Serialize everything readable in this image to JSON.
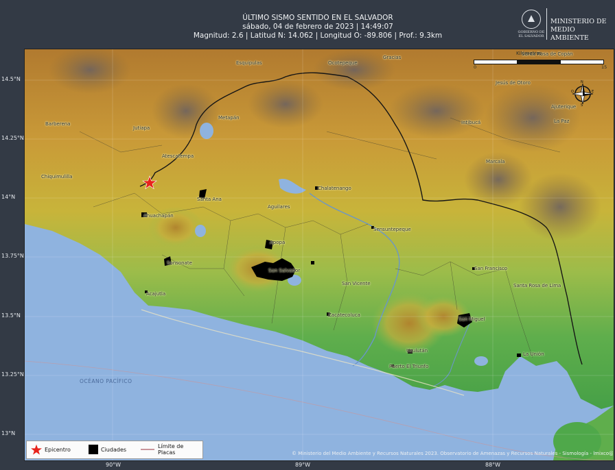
{
  "header": {
    "line1": "ÚLTIMO SISMO SENTIDO EN EL SALVADOR",
    "line2": "sábado, 04 de febrero de 2023 | 14:49:07",
    "line3": "Magnitud: 2.6 | Latitud N: 14.062 | Longitud O: -89.806 | Prof.: 9.3km"
  },
  "ministry": {
    "seal_text": "GOBIERNO DE EL SALVADOR",
    "name_line1": "MINISTERIO DE",
    "name_line2": "MEDIO AMBIENTE"
  },
  "axes": {
    "lat_ticks": [
      "14.5°N",
      "14.25°N",
      "14°N",
      "13.75°N",
      "13.5°N",
      "13.25°N",
      "13°N"
    ],
    "lon_ticks": [
      "90°W",
      "89°W",
      "88°W"
    ]
  },
  "places": [
    "Esquipulas",
    "Ocotepeque",
    "Gracias",
    "Santa Rosa de Copán",
    "Barberena",
    "Jutiapa",
    "Metapán",
    "Jesús de Otoro",
    "Ajuterique",
    "La Paz",
    "Intibucá",
    "Atescatempa",
    "Marcala",
    "Chiquimulilla",
    "Chalatenango",
    "Santa Ana",
    "Aguilares",
    "Ahuachapán",
    "Sensuntepeque",
    "Apopa",
    "Sonsonate",
    "San Salvador",
    "San Francisco",
    "Acajutla",
    "San Vicente",
    "Santa Rosa de Lima",
    "Zacatecoluca",
    "San Miguel",
    "Usulután",
    "La Unión",
    "Puerto El Triunfo"
  ],
  "ocean_label": "OCÉANO PACÍFICO",
  "scale": {
    "title": "Kilómetros",
    "n0": "0",
    "n1": "15"
  },
  "compass": {
    "n": "N",
    "s": "S",
    "e": "E",
    "o": "O"
  },
  "legend": {
    "epicenter": "Epicentro",
    "cities": "Ciudades",
    "plates": "Límite de Placas"
  },
  "epicenter": {
    "lat": 14.062,
    "lon": -89.806
  },
  "colors": {
    "ocean": "#8fb3df",
    "lowland": "#4fa84a",
    "midland": "#c8b43a",
    "highland": "#b5772a",
    "peak": "#7a6a62",
    "epicenter": "#e8231b",
    "plate_boundary": "#c9959a"
  },
  "credit": "© Ministerio del Medio Ambiente y Recursos Naturales 2023. Observatorio de Amenazas y Recursos Naturales - Sismología - lmixco@marn.gob.sv"
}
